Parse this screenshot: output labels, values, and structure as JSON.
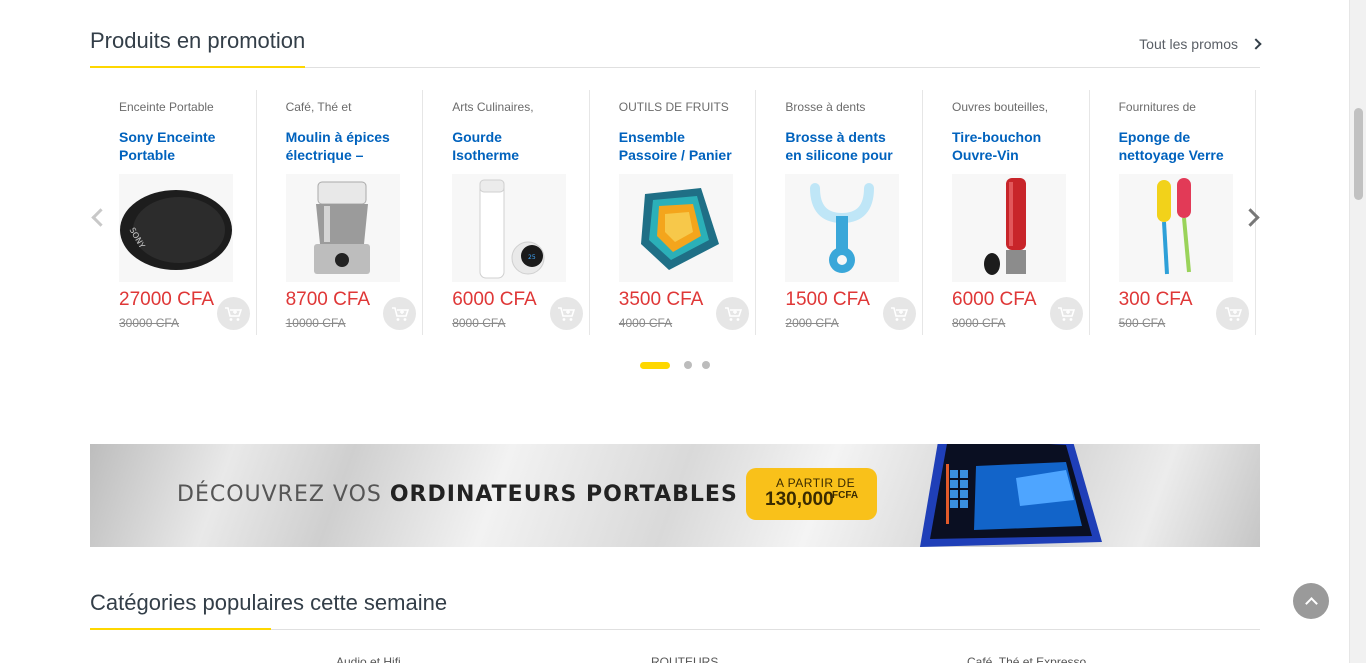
{
  "promo_section": {
    "title": "Produits en promotion",
    "see_all": "Tout les promos"
  },
  "products": [
    {
      "category": "Enceinte Portable",
      "name": "Sony Enceinte Portable",
      "price": "27000 CFA",
      "old_price": "30000 CFA",
      "image_icon": "speaker-icon"
    },
    {
      "category": "Café, Thé et",
      "name": "Moulin à épices électrique –",
      "price": "8700 CFA",
      "old_price": "10000 CFA",
      "image_icon": "grinder-icon"
    },
    {
      "category": "Arts Culinaires,",
      "name": "Gourde Isotherme",
      "price": "6000 CFA",
      "old_price": "8000 CFA",
      "image_icon": "bottle-icon"
    },
    {
      "category": "OUTILS DE FRUITS",
      "name": "Ensemble Passoire / Panier",
      "price": "3500 CFA",
      "old_price": "4000 CFA",
      "image_icon": "colander-icon"
    },
    {
      "category": "Brosse à dents",
      "name": "Brosse à dents en silicone pour",
      "price": "1500 CFA",
      "old_price": "2000 CFA",
      "image_icon": "toothbrush-icon"
    },
    {
      "category": "Ouvres bouteilles,",
      "name": "Tire-bouchon Ouvre-Vin",
      "price": "6000 CFA",
      "old_price": "8000 CFA",
      "image_icon": "corkscrew-icon"
    },
    {
      "category": "Fournitures de",
      "name": "Eponge de nettoyage Verre",
      "price": "300 CFA",
      "old_price": "500 CFA",
      "image_icon": "sponge-brush-icon"
    }
  ],
  "carousel": {
    "pages": 3,
    "active_page": 1
  },
  "banner": {
    "text_light": "DÉCOUVREZ VOS ",
    "text_bold": "ORDINATEURS PORTABLES",
    "badge_line1": "A PARTIR DE",
    "badge_line2": "130,000",
    "badge_unit": "FCFA"
  },
  "categories_section": {
    "title": "Catégories populaires cette semaine",
    "items": [
      "Audio et Hifi",
      "ROUTEURS",
      "Café, Thé et Expresso"
    ]
  },
  "colors": {
    "accent": "#fed700",
    "price": "#df3737",
    "link": "#0062bd",
    "badge": "#f9c11a"
  }
}
